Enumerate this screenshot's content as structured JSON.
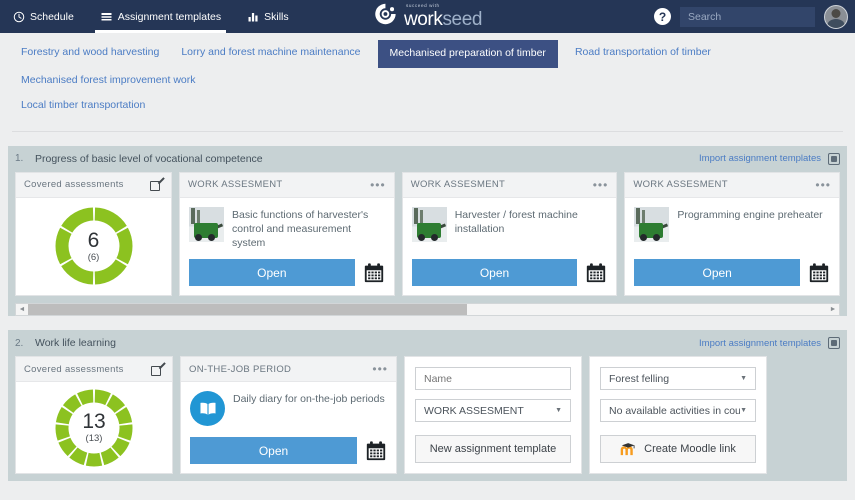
{
  "topbar": {
    "nav": [
      {
        "label": "Schedule",
        "icon": "clock-icon",
        "active": false
      },
      {
        "label": "Assignment templates",
        "icon": "list-icon",
        "active": true
      },
      {
        "label": "Skills",
        "icon": "bar-chart-icon",
        "active": false
      }
    ],
    "logo": {
      "tagline": "succeed with",
      "name": "work",
      "name_tail": "seed"
    },
    "help_label": "?",
    "search": {
      "placeholder": "Search",
      "value": ""
    },
    "avatar_label": "user-avatar"
  },
  "categories": [
    {
      "label": "Forestry and wood harvesting",
      "selected": false
    },
    {
      "label": "Lorry and forest machine maintenance",
      "selected": false
    },
    {
      "label": "Mechanised preparation of timber",
      "selected": true
    },
    {
      "label": "Road transportation of timber",
      "selected": false
    },
    {
      "label": "Mechanised forest improvement work",
      "selected": false
    },
    {
      "label": "Local timber transportation",
      "selected": false
    }
  ],
  "sections": [
    {
      "number": "1.",
      "title": "Progress of basic level of vocational competence",
      "import_label": "Import assignment templates",
      "donut": {
        "header": "Covered assessments",
        "value": "6",
        "total": "(6)",
        "segments": 6,
        "filled": 6,
        "color": "#8cc220"
      },
      "cards": [
        {
          "type": "WORK ASSESMENT",
          "title": "Basic functions of harvester's control and measurement system",
          "open_label": "Open",
          "icon": "harvester-photo",
          "menu": "•••"
        },
        {
          "type": "WORK ASSESMENT",
          "title": "Harvester / forest machine installation",
          "open_label": "Open",
          "icon": "harvester-photo",
          "menu": "•••"
        },
        {
          "type": "WORK ASSESMENT",
          "title": "Programming engine preheater",
          "open_label": "Open",
          "icon": "harvester-photo",
          "menu": "•••"
        }
      ],
      "scrollbar": {
        "left_arrow": "◄",
        "right_arrow": "►",
        "thumb_percent": 55
      }
    },
    {
      "number": "2.",
      "title": "Work life learning",
      "import_label": "Import assignment templates",
      "donut": {
        "header": "Covered assessments",
        "value": "13",
        "total": "(13)",
        "segments": 13,
        "filled": 13,
        "color": "#8cc220"
      },
      "cards": [
        {
          "type": "ON-THE-JOB PERIOD",
          "title": "Daily diary for on-the-job periods",
          "open_label": "Open",
          "icon": "book-icon",
          "menu": "•••"
        }
      ],
      "form_left": {
        "name_placeholder": "Name",
        "name_value": "",
        "type_select": "WORK ASSESMENT",
        "button_label": "New assignment template"
      },
      "form_right": {
        "course_select": "Forest felling",
        "activity_select": "No available activities in cou",
        "button_label": "Create Moodle link",
        "button_icon": "moodle-icon"
      }
    }
  ],
  "colors": {
    "topbar": "#253656",
    "accent_blue": "#4b7cc4",
    "selected_tab": "#3c5083",
    "panel": "#c7d2d4",
    "open_button": "#4e9ad4",
    "donut_green": "#8cc220",
    "book_blue": "#2196d4"
  }
}
